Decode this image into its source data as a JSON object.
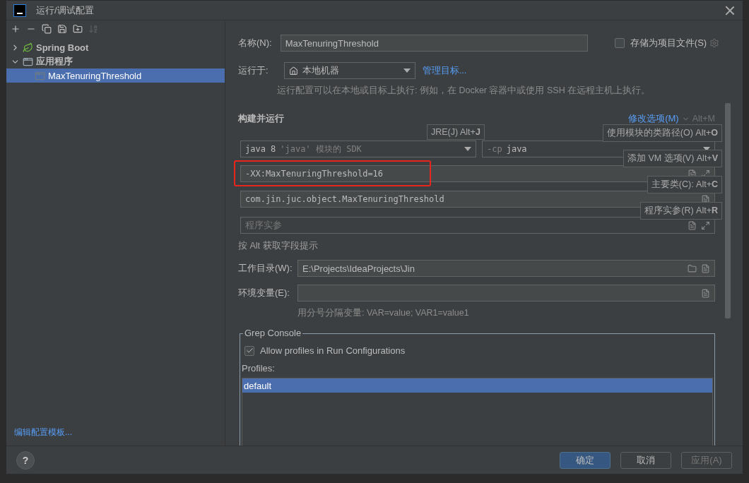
{
  "window": {
    "title": "运行/调试配置"
  },
  "toolbar": [
    {
      "kind": "add",
      "disabled": false
    },
    {
      "kind": "remove",
      "disabled": false
    },
    {
      "kind": "copy",
      "disabled": false
    },
    {
      "kind": "save",
      "disabled": false
    },
    {
      "kind": "folder",
      "disabled": false
    },
    {
      "kind": "sort",
      "disabled": true
    }
  ],
  "tree": [
    {
      "label": "Spring Boot",
      "kind": "spring",
      "expanded": false,
      "selected": false
    },
    {
      "label": "应用程序",
      "kind": "application",
      "expanded": true,
      "selected": false,
      "children": [
        {
          "label": "MaxTenuringThreshold",
          "kind": "config",
          "selected": true
        }
      ]
    }
  ],
  "edit_templates_link": "编辑配置模板...",
  "form": {
    "name_label": "名称(N):",
    "name_value": "MaxTenuringThreshold",
    "store_checkbox": {
      "label": "存储为项目文件(S)",
      "checked": false
    },
    "run_on_label": "运行于:",
    "run_on_value": "本地机器",
    "manage_link": "管理目标...",
    "run_on_hint": "运行配置可以在本地或目标上执行: 例如，在 Docker 容器中或使用 SSH 在远程主机上执行。",
    "build_title": "构建并运行",
    "modify_link": "修改选项(M)",
    "modify_shortcut": "Alt+M",
    "sdk": {
      "value": "java 8",
      "detail": "'java' 模块的 SDK"
    },
    "classpath": {
      "prefix": "-cp",
      "value": "java"
    },
    "vm_options": {
      "value": "-XX:MaxTenuringThreshold=16",
      "highlighted": true
    },
    "main_class": "com.jin.juc.object.MaxTenuringThreshold",
    "program_args": {
      "placeholder": "程序实参"
    },
    "alt_hint": "按 Alt 获取字段提示",
    "workdir_label": "工作目录(W):",
    "workdir_value": "E:\\Projects\\IdeaProjects\\Jin",
    "env_label": "环境变量(E):",
    "env_hint": "用分号分隔变量: VAR=value; VAR1=value1"
  },
  "tooltips": [
    "JRE(J) Alt+**J**",
    "使用模块的类路径(O) Alt+**O**",
    "添加 VM 选项(V) Alt+**V**",
    "主要类(C): Alt+**C**",
    "程序实参(R) Alt+**R**"
  ],
  "grep_console": {
    "title": "Grep Console",
    "checkbox": {
      "label": "Allow profiles in Run Configurations",
      "checked": true
    },
    "profiles_label": "Profiles:",
    "profiles": [
      {
        "label": "default",
        "selected": true
      }
    ]
  },
  "help_button": "?",
  "buttons": [
    {
      "label": "确定",
      "kind": "primary",
      "disabled": false
    },
    {
      "label": "取消",
      "kind": "normal",
      "disabled": false
    },
    {
      "label": "应用(A)",
      "kind": "normal",
      "disabled": true
    }
  ]
}
